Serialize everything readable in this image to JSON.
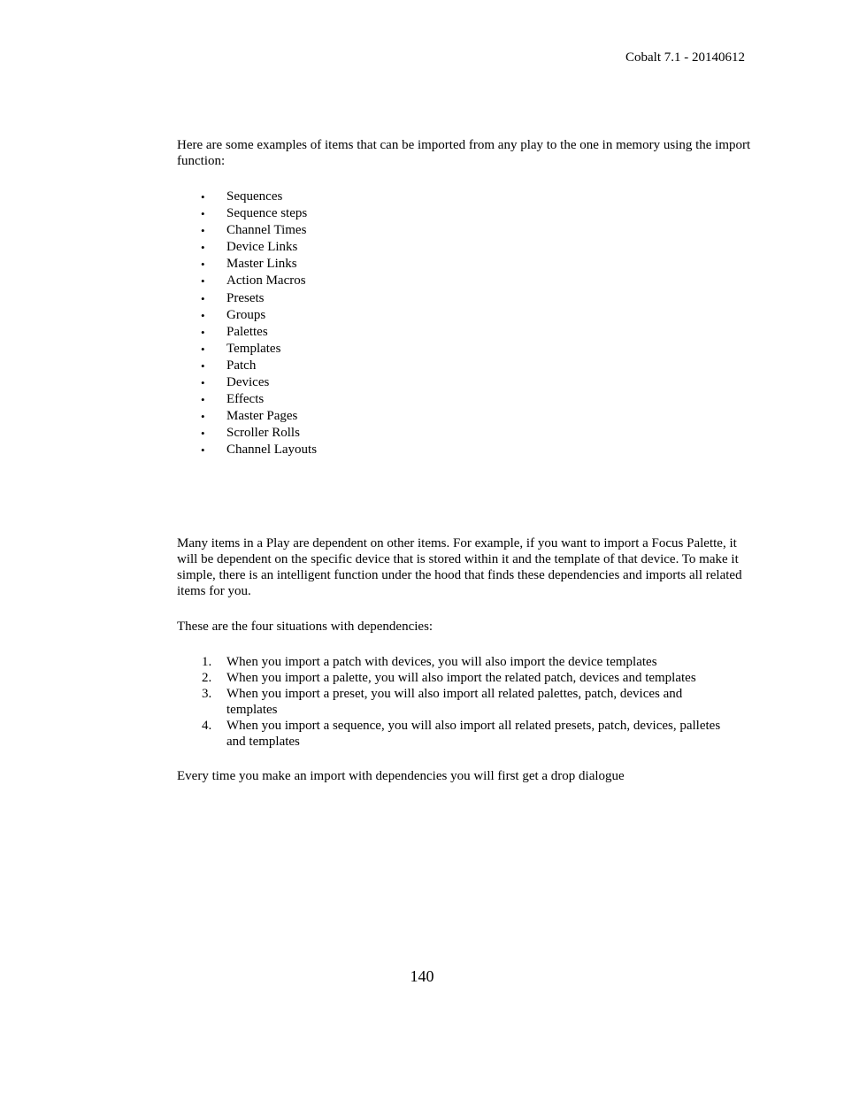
{
  "header": {
    "document_title": "Cobalt 7.1 - 20140612"
  },
  "intro": "Here are some examples of items that can be imported from any play to the one in memory using the import function:",
  "import_items": [
    "Sequences",
    "Sequence steps",
    "Channel Times",
    "Device Links",
    "Master Links",
    "Action Macros",
    "Presets",
    "Groups",
    "Palettes",
    "Templates",
    "Patch",
    "Devices",
    "Effects",
    "Master Pages",
    "Scroller Rolls",
    "Channel Layouts"
  ],
  "bullet_glyph": "•",
  "dependencies_paragraph": "Many items in a Play are dependent on other items. For example, if you want to import a Focus Palette, it will be dependent on the specific device that is stored within it and the template of that device. To make it simple, there is an intelligent function under the hood that finds these dependencies and imports all related items for you.",
  "situations_intro": "These are the four situations with dependencies:",
  "situations": [
    {
      "number": "1.",
      "text": "When you import a patch with devices, you will also import the device templates"
    },
    {
      "number": "2.",
      "text": "When you import a palette, you will also import the related patch, devices and templates"
    },
    {
      "number": "3.",
      "text": "When you import a preset, you will also import all related palettes, patch, devices and templates"
    },
    {
      "number": "4.",
      "text": "When you import a sequence, you will also import all related presets, patch, devices, palletes and templates"
    }
  ],
  "closing": "Every time you make an import with dependencies you will first get a drop dialogue",
  "footer": {
    "page_number": "140"
  }
}
